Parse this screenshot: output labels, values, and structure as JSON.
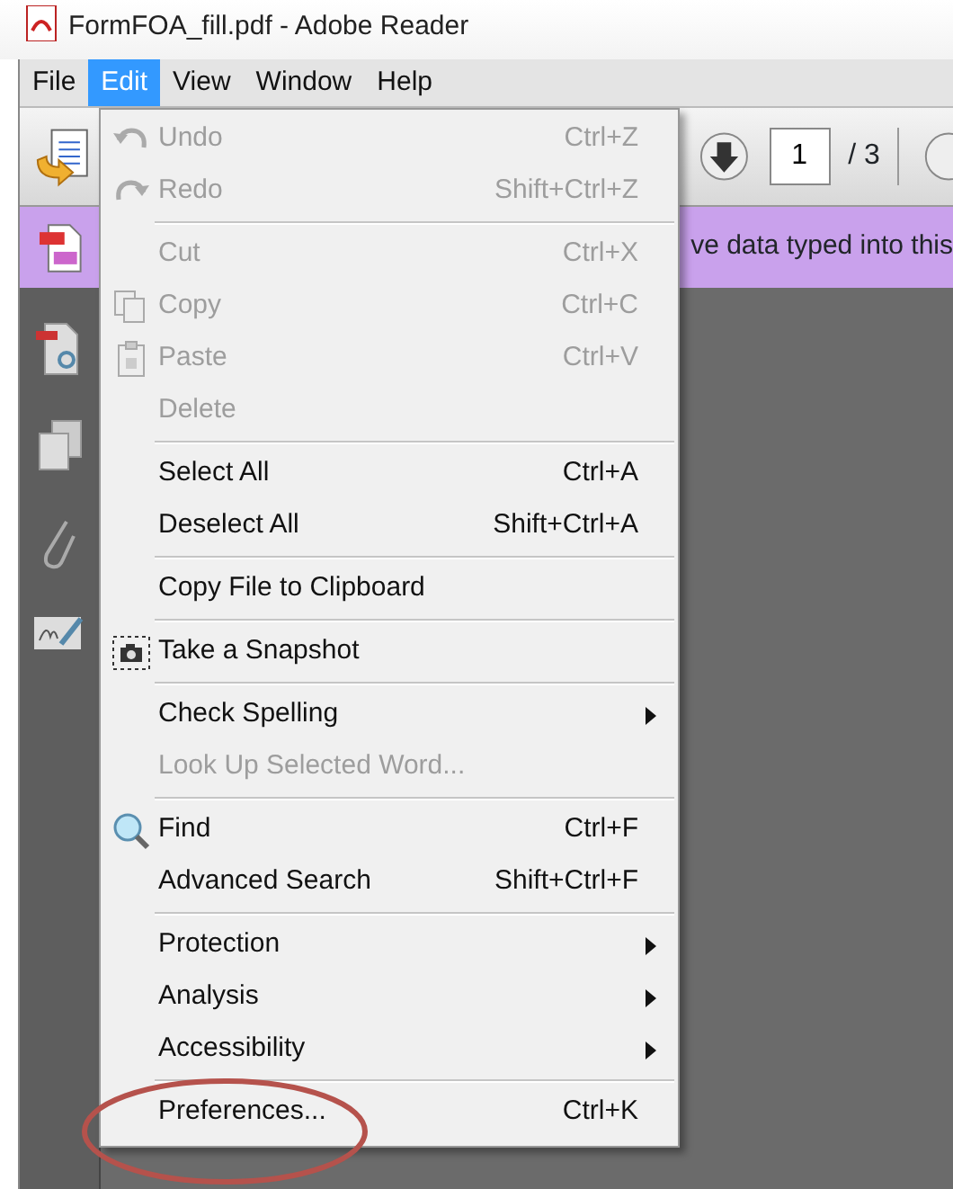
{
  "window": {
    "title": "FormFOA_fill.pdf - Adobe Reader"
  },
  "menubar": [
    {
      "label": "File",
      "selected": false
    },
    {
      "label": "Edit",
      "selected": true
    },
    {
      "label": "View",
      "selected": false
    },
    {
      "label": "Window",
      "selected": false
    },
    {
      "label": "Help",
      "selected": false
    }
  ],
  "toolbar": {
    "page_field": {
      "value": "1"
    },
    "page_count": "/ 3"
  },
  "message_bar": {
    "text": "ve data typed into this"
  },
  "edit_menu": {
    "groups": [
      [
        {
          "kind": "undo",
          "label": "Undo",
          "shortcut": "Ctrl+Z",
          "disabled": true
        },
        {
          "kind": "redo",
          "label": "Redo",
          "shortcut": "Shift+Ctrl+Z",
          "disabled": true
        }
      ],
      [
        {
          "kind": "plain",
          "label": "Cut",
          "shortcut": "Ctrl+X",
          "disabled": true
        },
        {
          "kind": "copy",
          "label": "Copy",
          "shortcut": "Ctrl+C",
          "disabled": true
        },
        {
          "kind": "paste",
          "label": "Paste",
          "shortcut": "Ctrl+V",
          "disabled": true
        },
        {
          "kind": "plain",
          "label": "Delete",
          "disabled": true
        }
      ],
      [
        {
          "kind": "plain",
          "label": "Select All",
          "shortcut": "Ctrl+A",
          "disabled": false
        },
        {
          "kind": "plain",
          "label": "Deselect All",
          "shortcut": "Shift+Ctrl+A",
          "disabled": false
        }
      ],
      [
        {
          "kind": "plain",
          "label": "Copy File to Clipboard",
          "disabled": false
        }
      ],
      [
        {
          "kind": "snapshot",
          "label": "Take a Snapshot",
          "disabled": false
        }
      ],
      [
        {
          "kind": "plain",
          "label": "Check Spelling",
          "disabled": false,
          "submenu": true
        },
        {
          "kind": "plain",
          "label": "Look Up Selected Word...",
          "disabled": true
        }
      ],
      [
        {
          "kind": "find",
          "label": "Find",
          "shortcut": "Ctrl+F",
          "disabled": false
        },
        {
          "kind": "plain",
          "label": "Advanced Search",
          "shortcut": "Shift+Ctrl+F",
          "disabled": false
        }
      ],
      [
        {
          "kind": "plain",
          "label": "Protection",
          "disabled": false,
          "submenu": true
        },
        {
          "kind": "plain",
          "label": "Analysis",
          "disabled": false,
          "submenu": true
        },
        {
          "kind": "plain",
          "label": "Accessibility",
          "disabled": false,
          "submenu": true
        }
      ],
      [
        {
          "kind": "plain",
          "label": "Preferences...",
          "shortcut": "Ctrl+K",
          "disabled": false
        }
      ]
    ]
  },
  "annotations": [
    {
      "kind": "ellipse"
    }
  ]
}
